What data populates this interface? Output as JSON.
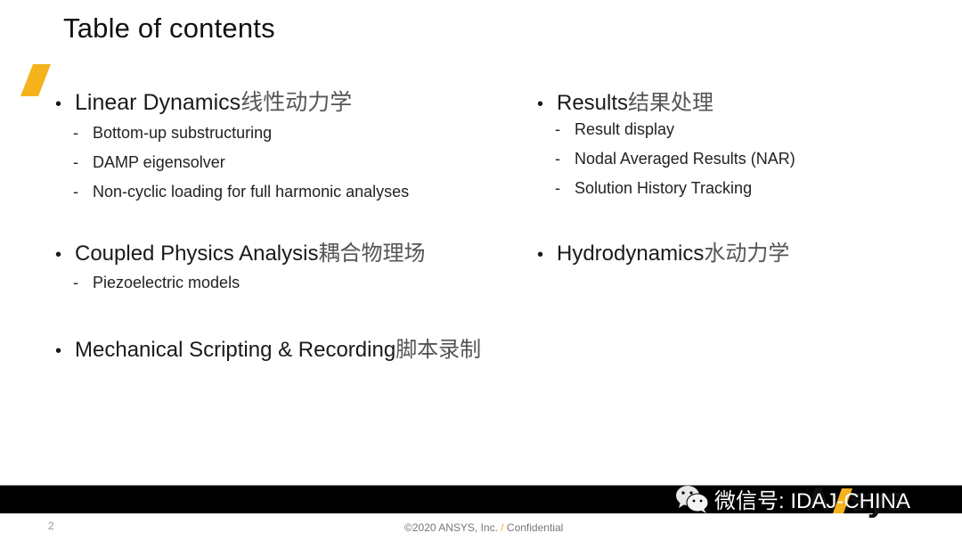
{
  "slide": {
    "title": "Table of contents",
    "accent_color": "#f5b21b",
    "left_column": [
      {
        "bullet": "•",
        "heading_en": "Linear Dynamics",
        "heading_cn": "线性动力学",
        "subitems": [
          {
            "dash": "-",
            "text": "Bottom-up substructuring"
          },
          {
            "dash": "-",
            "text": "DAMP eigensolver"
          },
          {
            "dash": "-",
            "text": "Non-cyclic loading for full harmonic analyses"
          }
        ]
      },
      {
        "bullet": "•",
        "heading_en": "Coupled Physics Analysis",
        "heading_cn": "耦合物理场",
        "subitems": [
          {
            "dash": "-",
            "text": "Piezoelectric models"
          }
        ]
      },
      {
        "bullet": "•",
        "heading_en": "Mechanical Scripting & Recording",
        "heading_cn": "脚本录制",
        "subitems": []
      }
    ],
    "right_column": [
      {
        "bullet": "•",
        "heading_en": "Results",
        "heading_cn": "结果处理",
        "subitems": [
          {
            "dash": "-",
            "text": "Result display"
          },
          {
            "dash": "-",
            "text": "Nodal Averaged Results (NAR)"
          },
          {
            "dash": "-",
            "text": "Solution History Tracking"
          }
        ]
      },
      {
        "bullet": "•",
        "heading_en": "Hydrodynamics",
        "heading_cn": "水动力学",
        "subitems": []
      }
    ]
  },
  "footer": {
    "page_number": "2",
    "copyright_prefix": "©2020 ANSYS, Inc. ",
    "copyright_sep": "/",
    "copyright_suffix": " Confidential",
    "logo_text": "Ansys"
  },
  "watermark": {
    "text": "微信号: IDAJ-CHINA"
  }
}
